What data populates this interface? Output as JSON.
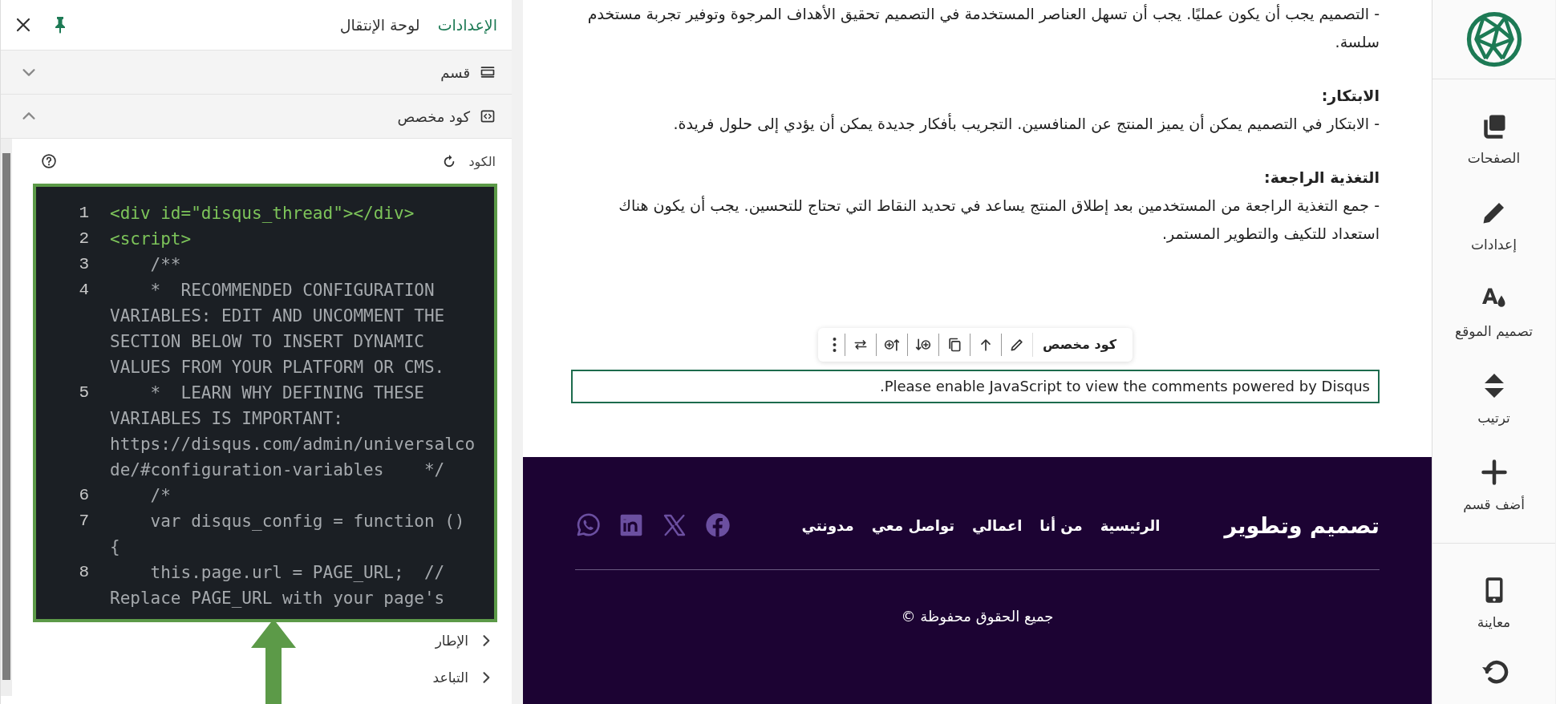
{
  "panel": {
    "tabs": [
      {
        "label": "الإعدادات",
        "selected": true
      },
      {
        "label": "لوحة الإنتقال",
        "selected": false
      }
    ],
    "sections": [
      {
        "label": "قسم",
        "kind": "section",
        "expanded": false
      },
      {
        "label": "كود مخصص",
        "kind": "code",
        "expanded": true
      }
    ],
    "field_label": "الكود",
    "code_lines": [
      {
        "number": "1",
        "kind": "markup",
        "text": "<div id=\"disqus_thread\"></div>"
      },
      {
        "number": "2",
        "kind": "markup",
        "text": "<script>"
      },
      {
        "number": "3",
        "kind": "comment",
        "text": "    /**"
      },
      {
        "number": "4",
        "kind": "comment",
        "text": "    *  RECOMMENDED CONFIGURATION VARIABLES: EDIT AND UNCOMMENT THE SECTION BELOW TO INSERT DYNAMIC VALUES FROM YOUR PLATFORM OR CMS."
      },
      {
        "number": "5",
        "kind": "comment",
        "text": "    *  LEARN WHY DEFINING THESE VARIABLES IS IMPORTANT: https://disqus.com/admin/universalcode/#configuration-variables    */"
      },
      {
        "number": "6",
        "kind": "comment",
        "text": "    /*"
      },
      {
        "number": "7",
        "kind": "comment",
        "text": "    var disqus_config = function () {"
      },
      {
        "number": "8",
        "kind": "comment",
        "text": "    this.page.url = PAGE_URL;  // Replace PAGE_URL with your page's"
      }
    ],
    "subsections": [
      {
        "label": "الإطار",
        "expanded": false
      },
      {
        "label": "التباعد",
        "expanded": false
      }
    ]
  },
  "content": {
    "blocks": [
      {
        "kind": "paragraph",
        "text": "- التصميم يجب أن يكون عمليًا. يجب أن تسهل العناصر المستخدمة في التصميم تحقيق الأهداف المرجوة وتوفير تجربة مستخدم سلسة."
      },
      {
        "kind": "heading",
        "text": "الابتكار:"
      },
      {
        "kind": "paragraph",
        "text": "- الابتكار في التصميم يمكن أن يميز المنتج عن المنافسين. التجريب بأفكار جديدة يمكن أن يؤدي إلى حلول فريدة."
      },
      {
        "kind": "heading",
        "text": "التغذية الراجعة:"
      },
      {
        "kind": "paragraph",
        "text": "- جمع التغذية الراجعة من المستخدمين بعد إطلاق المنتج يساعد في تحديد النقاط التي تحتاج للتحسين. يجب أن يكون هناك استعداد للتكيف والتطوير المستمر."
      }
    ],
    "toolbar": {
      "label": "كود مخصص",
      "tools": [
        {
          "kind": "edit"
        },
        {
          "kind": "up"
        },
        {
          "kind": "copy"
        },
        {
          "kind": "insert-below"
        },
        {
          "kind": "insert-above"
        },
        {
          "kind": "swap"
        },
        {
          "kind": "more"
        }
      ]
    },
    "embed_text": "Please enable JavaScript to view the comments powered by Disqus."
  },
  "footer": {
    "brand": "تصميم وتطوير",
    "links": [
      "الرئيسية",
      "من أنا",
      "اعمالي",
      "تواصل معي",
      "مدونتي"
    ],
    "socials": [
      {
        "kind": "facebook"
      },
      {
        "kind": "x"
      },
      {
        "kind": "linkedin"
      },
      {
        "kind": "whatsapp"
      }
    ],
    "copyright": "جميع الحقوق محفوظة ©"
  },
  "sidebar": {
    "items": [
      {
        "label": "الصفحات",
        "kind": "pages"
      },
      {
        "label": "إعدادات",
        "kind": "settings"
      },
      {
        "label": "تصميم الموقع",
        "kind": "design"
      },
      {
        "label": "ترتيب",
        "kind": "order"
      },
      {
        "label": "أضف قسم",
        "kind": "add"
      },
      {
        "label": "معاينة",
        "kind": "preview"
      }
    ]
  }
}
